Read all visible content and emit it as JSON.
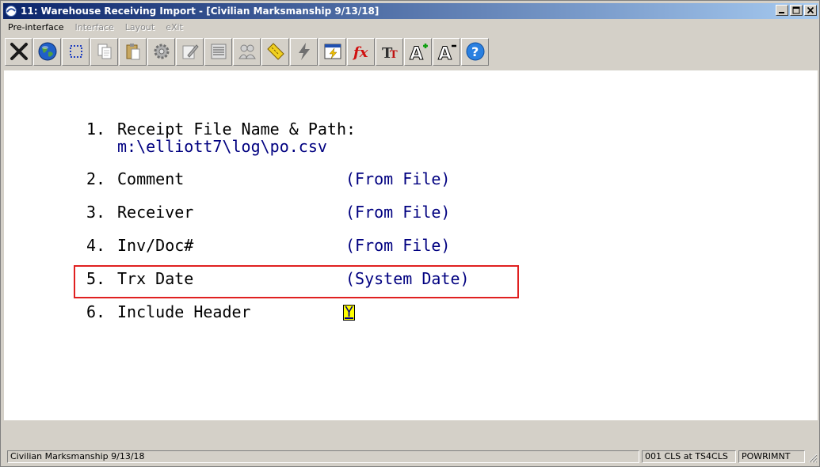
{
  "window": {
    "title": "11: Warehouse Receiving Import - [Civilian Marksmanship 9/13/18]"
  },
  "menu": [
    {
      "label": "Pre-interface",
      "enabled": true
    },
    {
      "label": "Interface",
      "enabled": false
    },
    {
      "label": "Layout",
      "enabled": false
    },
    {
      "label": "eXit",
      "enabled": false
    }
  ],
  "toolbar": {
    "icons": [
      "close-x-icon",
      "globe-icon",
      "select-rect-icon",
      "copy-icon",
      "paste-icon",
      "settings-gear-icon",
      "edit-note-icon",
      "list-icon",
      "users-icon",
      "ruler-icon",
      "lightning-icon",
      "window-lightning-icon",
      "fx-function-icon",
      "text-size-icon",
      "font-increase-icon",
      "font-decrease-icon",
      "help-icon"
    ],
    "fx_label": "fx",
    "tt_label": "TT",
    "font_inc_label": "A",
    "font_dec_label": "A",
    "help_label": "?"
  },
  "form": {
    "fields": [
      {
        "number": "1.",
        "label": "Receipt File Name & Path:",
        "value": "m:\\elliott7\\log\\po.csv"
      },
      {
        "number": "2.",
        "label": "Comment",
        "value": "(From File)"
      },
      {
        "number": "3.",
        "label": "Receiver",
        "value": "(From File)"
      },
      {
        "number": "4.",
        "label": "Inv/Doc#",
        "value": "(From File)"
      },
      {
        "number": "5.",
        "label": "Trx Date",
        "value": "(System Date)"
      },
      {
        "number": "6.",
        "label": "Include Header",
        "value": "Y"
      }
    ]
  },
  "status": {
    "company": "Civilian Marksmanship 9/13/18",
    "session": "001 CLS at TS4CLS",
    "program": "POWRIMNT"
  },
  "colors": {
    "title_bar": "#0a246a",
    "value_text": "#000080",
    "highlight_border": "#e02020",
    "input_bg": "#ffff00"
  }
}
